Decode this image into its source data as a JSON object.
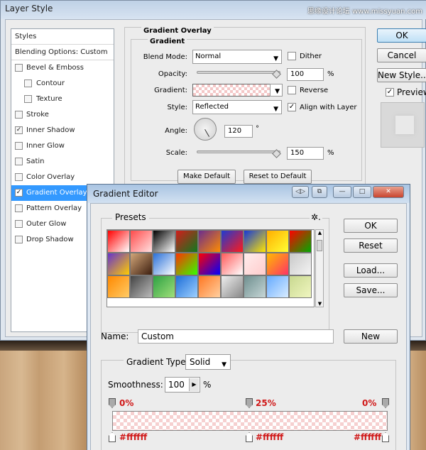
{
  "layer_style": {
    "title": "Layer Style",
    "watermark": "思缘设计论坛 www.missyuan.com",
    "styles_header": "Styles",
    "blending_options": "Blending Options: Custom",
    "effects": [
      {
        "label": "Bevel & Emboss",
        "checked": false,
        "sub": false,
        "selected": false
      },
      {
        "label": "Contour",
        "checked": false,
        "sub": true,
        "selected": false
      },
      {
        "label": "Texture",
        "checked": false,
        "sub": true,
        "selected": false
      },
      {
        "label": "Stroke",
        "checked": false,
        "sub": false,
        "selected": false
      },
      {
        "label": "Inner Shadow",
        "checked": true,
        "sub": false,
        "selected": false
      },
      {
        "label": "Inner Glow",
        "checked": false,
        "sub": false,
        "selected": false
      },
      {
        "label": "Satin",
        "checked": false,
        "sub": false,
        "selected": false
      },
      {
        "label": "Color Overlay",
        "checked": false,
        "sub": false,
        "selected": false
      },
      {
        "label": "Gradient Overlay",
        "checked": true,
        "sub": false,
        "selected": true
      },
      {
        "label": "Pattern Overlay",
        "checked": false,
        "sub": false,
        "selected": false
      },
      {
        "label": "Outer Glow",
        "checked": false,
        "sub": false,
        "selected": false
      },
      {
        "label": "Drop Shadow",
        "checked": false,
        "sub": false,
        "selected": false
      }
    ],
    "gradient_overlay": {
      "group_title": "Gradient Overlay",
      "sub_title": "Gradient",
      "blend_mode_label": "Blend Mode:",
      "blend_mode_value": "Normal",
      "dither_label": "Dither",
      "dither_checked": false,
      "opacity_label": "Opacity:",
      "opacity_value": "100",
      "opacity_unit": "%",
      "opacity_fraction": 1.0,
      "gradient_label": "Gradient:",
      "reverse_label": "Reverse",
      "reverse_checked": false,
      "style_label": "Style:",
      "style_value": "Reflected",
      "align_label": "Align with Layer",
      "align_checked": true,
      "angle_label": "Angle:",
      "angle_value": "120",
      "angle_unit": "°",
      "scale_label": "Scale:",
      "scale_value": "150",
      "scale_unit": "%",
      "make_default": "Make Default",
      "reset_default": "Reset to Default"
    },
    "buttons": {
      "ok": "OK",
      "cancel": "Cancel",
      "new_style": "New Style..."
    },
    "preview_label": "Preview",
    "preview_checked": true
  },
  "gradient_editor": {
    "title": "Gradient Editor",
    "titlebar_buttons": [
      "◁▷",
      "⧉",
      "—",
      "□",
      "✕"
    ],
    "presets_label": "Presets",
    "presets_gear": "✲.",
    "buttons": {
      "ok": "OK",
      "reset": "Reset",
      "load": "Load...",
      "save": "Save...",
      "new": "New"
    },
    "name_label": "Name:",
    "name_value": "Custom",
    "gradient_type_label": "Gradient Type:",
    "gradient_type_value": "Solid",
    "smoothness_label": "Smoothness:",
    "smoothness_value": "100",
    "smoothness_unit": "%",
    "stops": {
      "opacity_left": "0%",
      "opacity_mid": "25%",
      "opacity_right": "0%",
      "color_left": "#ffffff",
      "color_mid": "#ffffff",
      "color_right": "#ffffff"
    },
    "colors": {
      "accent": "#3399ff",
      "stop_text": "#d01818"
    }
  }
}
